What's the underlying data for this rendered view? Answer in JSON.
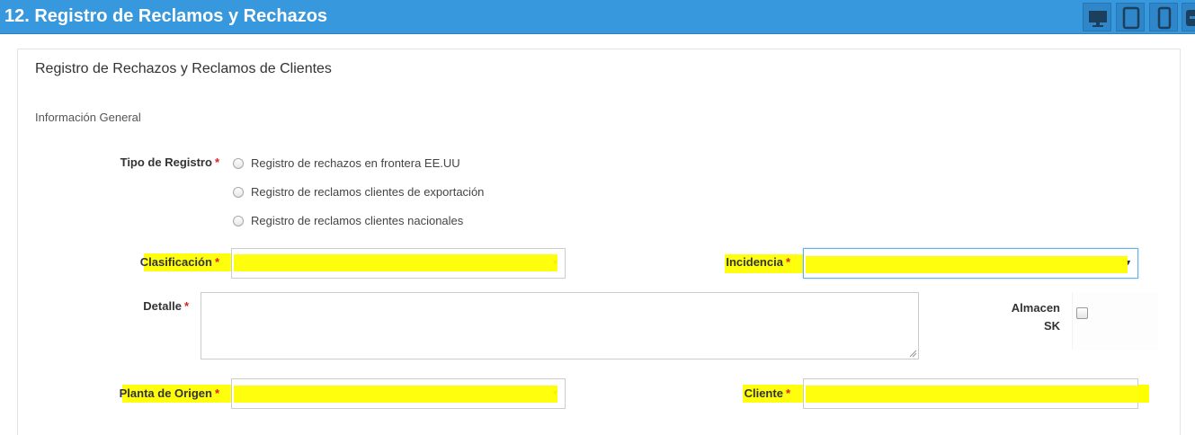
{
  "header": {
    "title": "12. Registro de Reclamos y Rechazos",
    "color": "#3898dd",
    "device_buttons": [
      {
        "name": "desktop-icon"
      },
      {
        "name": "tablet-icon"
      },
      {
        "name": "mobile-icon"
      },
      {
        "name": "collapse-icon"
      }
    ]
  },
  "panel": {
    "title": "Registro de Rechazos y Reclamos de Clientes",
    "section": "Información General"
  },
  "form": {
    "tipo_registro": {
      "label": "Tipo de Registro",
      "required": "*",
      "options": [
        "Registro de rechazos en frontera EE.UU",
        "Registro de reclamos clientes de exportación",
        "Registro de reclamos clientes nacionales"
      ]
    },
    "clasificacion": {
      "label": "Clasificación",
      "required": "*",
      "value": ""
    },
    "incidencia": {
      "label": "Incidencia",
      "required": "*",
      "value": ""
    },
    "detalle": {
      "label": "Detalle",
      "required": "*",
      "value": ""
    },
    "almacen": {
      "label_line1": "Almacen",
      "label_line2": "SK",
      "checked": false
    },
    "planta_origen": {
      "label": "Planta de Origen",
      "required": "*",
      "value": ""
    },
    "cliente": {
      "label": "Cliente",
      "required": "*",
      "value": ""
    }
  },
  "highlight_color": "#ffff00"
}
